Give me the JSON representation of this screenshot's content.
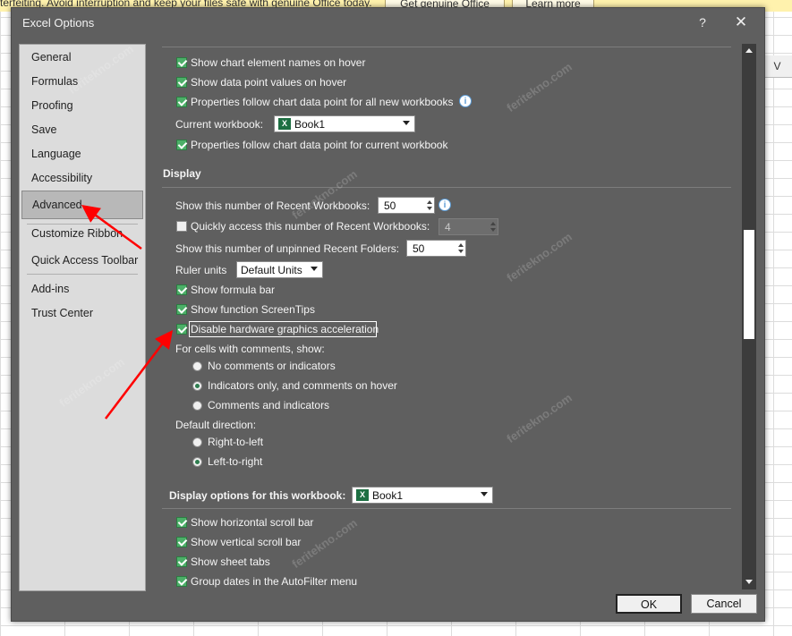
{
  "banner": {
    "text": "terfeiting. Avoid interruption and keep your files safe with genuine Office today.",
    "get_genuine_label": "Get genuine Office",
    "learn_more_label": "Learn more"
  },
  "sheet": {
    "column_header": "V"
  },
  "dialog": {
    "title": "Excel Options",
    "help_label": "?",
    "close_label": "✕"
  },
  "nav": {
    "items": [
      {
        "label": "General"
      },
      {
        "label": "Formulas"
      },
      {
        "label": "Proofing"
      },
      {
        "label": "Save"
      },
      {
        "label": "Language"
      },
      {
        "label": "Accessibility"
      },
      {
        "label": "Advanced"
      },
      {
        "label": "Customize Ribbon"
      },
      {
        "label": "Quick Access Toolbar"
      },
      {
        "label": "Add-ins"
      },
      {
        "label": "Trust Center"
      }
    ],
    "selected": "Advanced"
  },
  "chart_section": {
    "show_names_hover": "Show chart element names on hover",
    "show_values_hover": "Show data point values on hover",
    "props_follow_all": "Properties follow chart data point for all new workbooks",
    "current_workbook_label": "Current workbook:",
    "current_workbook_value": "Book1",
    "props_follow_current": "Properties follow chart data point for current workbook"
  },
  "display_section": {
    "heading": "Display",
    "recent_workbooks_label": "Show this number of Recent Workbooks:",
    "recent_workbooks_value": "50",
    "quick_access_label": "Quickly access this number of Recent Workbooks:",
    "quick_access_value": "4",
    "unpinned_folders_label": "Show this number of unpinned Recent Folders:",
    "unpinned_folders_value": "50",
    "ruler_units_label": "Ruler units",
    "ruler_units_value": "Default Units",
    "show_formula_bar": "Show formula bar",
    "show_function_tips": "Show function ScreenTips",
    "disable_hw_accel": "Disable hardware graphics acceleration",
    "comments_heading": "For cells with comments, show:",
    "comments_none": "No comments or indicators",
    "comments_indicators": "Indicators only, and comments on hover",
    "comments_both": "Comments and indicators",
    "direction_heading": "Default direction:",
    "direction_rtl": "Right-to-left",
    "direction_ltr": "Left-to-right"
  },
  "workbook_section": {
    "heading": "Display options for this workbook:",
    "workbook_value": "Book1",
    "show_hscroll": "Show horizontal scroll bar",
    "show_vscroll": "Show vertical scroll bar",
    "show_tabs": "Show sheet tabs",
    "group_dates": "Group dates in the AutoFilter menu"
  },
  "footer": {
    "ok_label": "OK",
    "cancel_label": "Cancel"
  },
  "watermark": "feritekno.com",
  "colors": {
    "dialog_bg": "#5f5f5f",
    "checkbox": "#4caf68",
    "arrow": "#ff0000",
    "banner": "#fff2ad"
  }
}
